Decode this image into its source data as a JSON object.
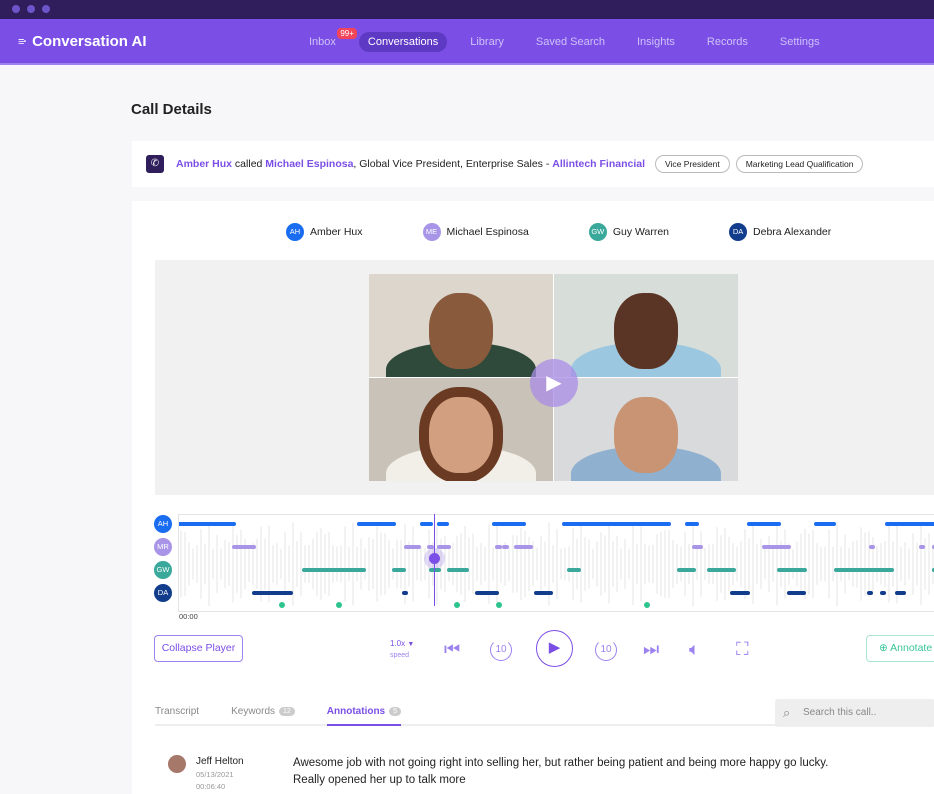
{
  "app": {
    "title": "Conversation AI"
  },
  "nav": {
    "items": [
      {
        "label": "Inbox",
        "badge": "99+"
      },
      {
        "label": "Conversations",
        "active": true
      },
      {
        "label": "Library"
      },
      {
        "label": "Saved Search"
      },
      {
        "label": "Insights"
      },
      {
        "label": "Records"
      },
      {
        "label": "Settings"
      }
    ]
  },
  "page": {
    "title": "Call Details"
  },
  "call": {
    "caller": "Amber Hux",
    "verb": " called ",
    "callee": "Michael Espinosa",
    "role": ", Global Vice President, Enterprise Sales - ",
    "company": "Allintech Financial",
    "tags": [
      "Vice President",
      "Marketing Lead Qualification"
    ]
  },
  "participants": [
    {
      "initials": "AH",
      "name": "Amber Hux",
      "color": "#1a6cf0"
    },
    {
      "initials": "ME",
      "name": "Michael Espinosa",
      "color": "#a995e8"
    },
    {
      "initials": "GW",
      "name": "Guy Warren",
      "color": "#3aa89a"
    },
    {
      "initials": "DA",
      "name": "Debra Alexander",
      "color": "#123d8c"
    }
  ],
  "timeline": {
    "rows": [
      {
        "initials": "AH",
        "color": "#1a6cf0"
      },
      {
        "initials": "MR",
        "color": "#a995e8"
      },
      {
        "initials": "GW",
        "color": "#3aa89a"
      },
      {
        "initials": "DA",
        "color": "#123d8c"
      }
    ],
    "start_time": "00:00",
    "marker_color": "#2ec48e"
  },
  "player": {
    "collapse_label": "Collapse Player",
    "speed": "1.0x",
    "speed_label": "speed",
    "skip_back": "10",
    "skip_fwd": "10",
    "annotate_label": "Annotate"
  },
  "tabs": [
    {
      "label": "Transcript"
    },
    {
      "label": "Keywords",
      "count": "12"
    },
    {
      "label": "Annotations",
      "count": "5",
      "active": true
    }
  ],
  "search": {
    "placeholder": "Search this call.."
  },
  "annotation": {
    "author": "Jeff Helton",
    "date": "05/13/2021",
    "time": "00:06:40",
    "text": "Awesome job with not going right into selling her, but rather being patient and being more happy go lucky. Really opened her up to talk more"
  }
}
